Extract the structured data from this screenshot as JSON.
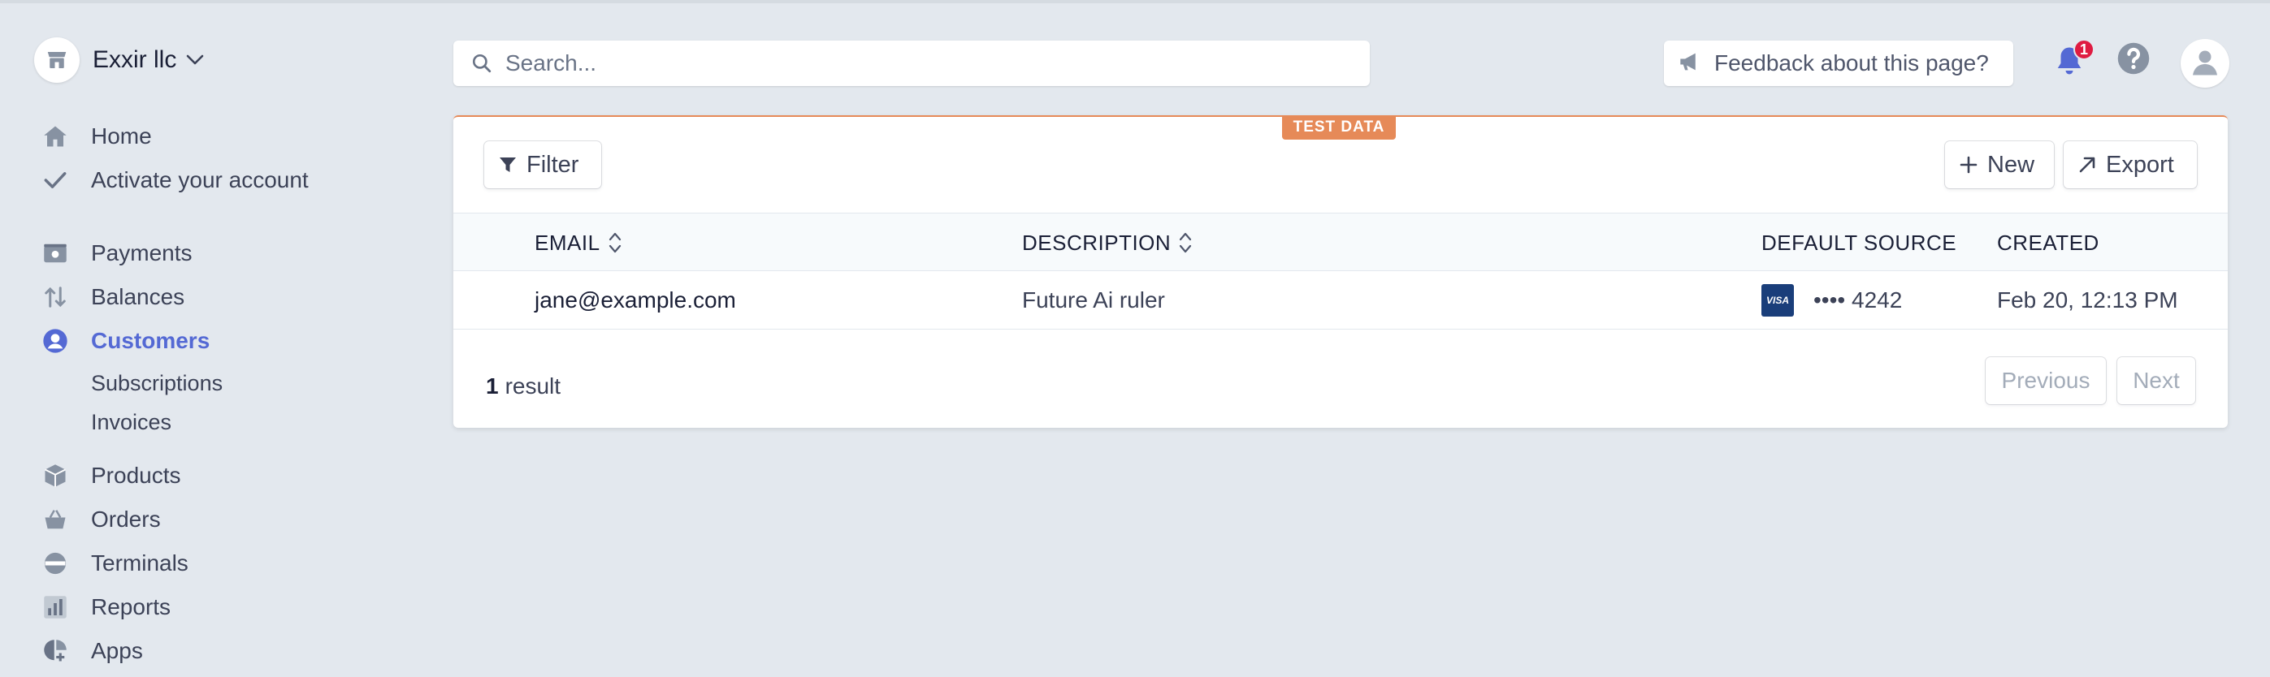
{
  "account": {
    "name": "Exxir llc"
  },
  "sidebar": {
    "items": [
      {
        "label": "Home",
        "icon": "home-icon"
      },
      {
        "label": "Activate your account",
        "icon": "check-icon"
      },
      {
        "label": "Payments",
        "icon": "payments-icon"
      },
      {
        "label": "Balances",
        "icon": "balances-icon"
      },
      {
        "label": "Customers",
        "icon": "customers-icon",
        "active": true
      },
      {
        "label": "Subscriptions",
        "sub": true
      },
      {
        "label": "Invoices",
        "sub": true
      },
      {
        "label": "Products",
        "icon": "products-icon"
      },
      {
        "label": "Orders",
        "icon": "orders-icon"
      },
      {
        "label": "Terminals",
        "icon": "terminals-icon"
      },
      {
        "label": "Reports",
        "icon": "reports-icon"
      },
      {
        "label": "Apps",
        "icon": "apps-icon"
      }
    ]
  },
  "header": {
    "search_placeholder": "Search...",
    "feedback_label": "Feedback about this page?",
    "notifications_count": "1"
  },
  "card": {
    "test_tag": "TEST DATA",
    "filter_label": "Filter",
    "new_label": "New",
    "export_label": "Export",
    "columns": {
      "email": "EMAIL",
      "description": "DESCRIPTION",
      "default_source": "DEFAULT SOURCE",
      "created": "CREATED"
    },
    "rows": [
      {
        "email": "jane@example.com",
        "description": "Future Ai ruler",
        "card_brand": "VISA",
        "source": "•••• 4242",
        "created": "Feb 20, 12:13 PM"
      }
    ],
    "result_count": "1",
    "result_label": "result",
    "prev_label": "Previous",
    "next_label": "Next"
  },
  "colors": {
    "accent": "#5469d4",
    "test_data": "#e68a58",
    "background": "#e3e8ee",
    "badge": "#df1b41"
  }
}
